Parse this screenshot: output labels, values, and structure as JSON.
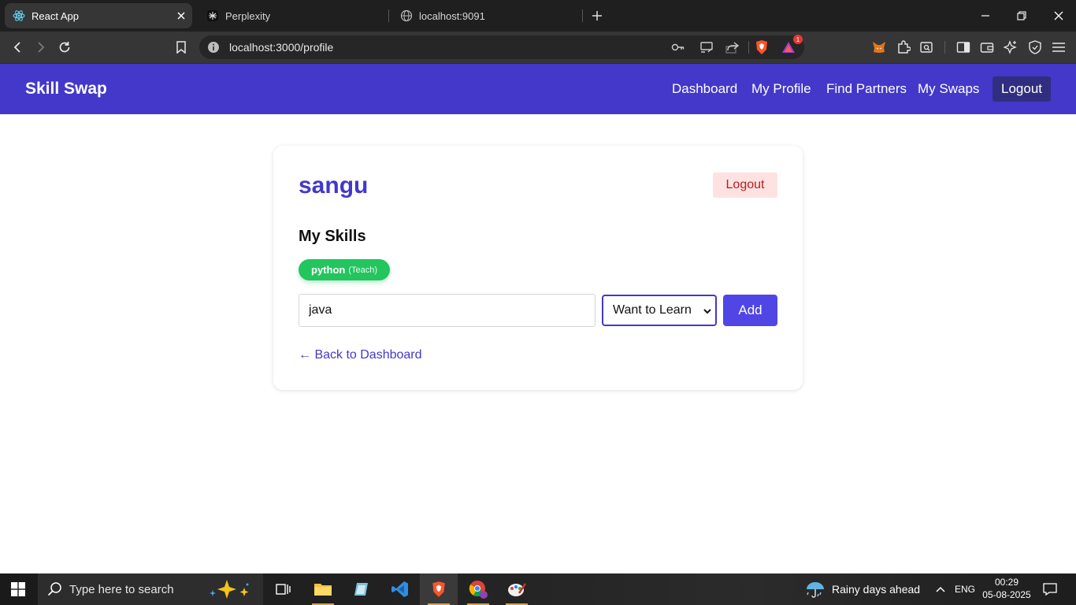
{
  "browser": {
    "tabs": [
      {
        "title": "React App",
        "active": true
      },
      {
        "title": "Perplexity",
        "active": false
      },
      {
        "title": "localhost:9091",
        "active": false
      }
    ],
    "url": "localhost:3000/profile",
    "brave_badge": "1"
  },
  "app": {
    "brand": "Skill Swap",
    "nav": {
      "dashboard": "Dashboard",
      "my_profile": "My Profile",
      "find_partners": "Find Partners",
      "my_swaps": "My Swaps",
      "logout": "Logout"
    },
    "profile": {
      "username": "sangu",
      "logout": "Logout",
      "skills_heading": "My Skills",
      "skills": [
        {
          "name": "python",
          "type": "(Teach)"
        }
      ],
      "new_skill_value": "java",
      "skill_type_selected": "Want to Learn",
      "add_label": "Add",
      "back_link": "← Back to Dashboard"
    },
    "colors": {
      "primary": "#4338ca",
      "nav_logout_bg": "#312e81",
      "chip_teach": "#22c55e",
      "logout_bg": "#fee2e2",
      "logout_text": "#b91c1c"
    }
  },
  "taskbar": {
    "search_placeholder": "Type here to search",
    "weather": "Rainy days ahead",
    "language": "ENG",
    "time": "00:29",
    "date": "05-08-2025"
  }
}
